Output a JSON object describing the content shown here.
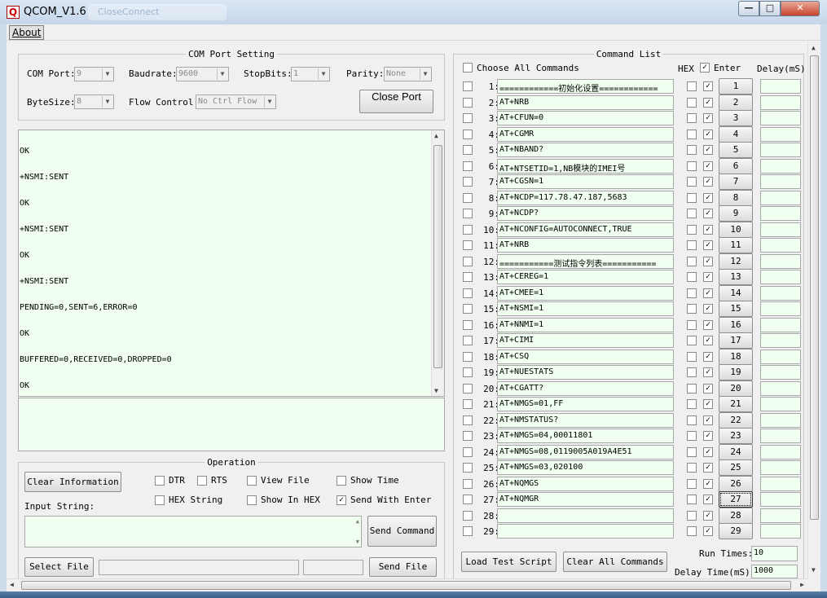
{
  "window": {
    "title": "QCOM_V1.6",
    "ghost_tab": "CloseConnect"
  },
  "menu": {
    "about": "About"
  },
  "com_port_setting": {
    "legend": "COM Port Setting",
    "com_port_label": "COM Port:",
    "com_port_value": "9",
    "baudrate_label": "Baudrate:",
    "baudrate_value": "9600",
    "stopbits_label": "StopBits:",
    "stopbits_value": "1",
    "parity_label": "Parity:",
    "parity_value": "None",
    "bytesize_label": "ByteSize:",
    "bytesize_value": "8",
    "flow_label": "Flow Control:",
    "flow_value": "No Ctrl Flow",
    "close_port": "Close Port"
  },
  "receive_lines": [
    "OK",
    "+NSMI:SENT",
    "OK",
    "+NSMI:SENT",
    "OK",
    "+NSMI:SENT",
    "PENDING=0,SENT=6,ERROR=0",
    "OK",
    "BUFFERED=0,RECEIVED=0,DROPPED=0",
    "OK"
  ],
  "operation": {
    "legend": "Operation",
    "clear_information": "Clear Information",
    "dtr": "DTR",
    "rts": "RTS",
    "view_file": "View File",
    "show_time": "Show Time",
    "hex_string": "HEX String",
    "show_in_hex": "Show In HEX",
    "send_with_enter": "Send With Enter",
    "input_string_label": "Input String:",
    "send_command": "Send Command",
    "select_file": "Select File",
    "send_file": "Send File"
  },
  "command_list": {
    "legend": "Command List",
    "choose_all": "Choose All Commands",
    "hex_header": "HEX",
    "enter_header": "Enter",
    "delay_header": "Delay(mS)",
    "commands": [
      "============初始化设置============",
      "AT+NRB",
      "AT+CFUN=0",
      "AT+CGMR",
      "AT+NBAND?",
      "AT+NTSETID=1,NB模块的IMEI号",
      "AT+CGSN=1",
      "AT+NCDP=117.78.47.187,5683",
      "AT+NCDP?",
      "AT+NCONFIG=AUTOCONNECT,TRUE",
      "AT+NRB",
      "===========测试指令列表===========",
      "AT+CEREG=1",
      "AT+CMEE=1",
      "AT+NSMI=1",
      "AT+NNMI=1",
      "AT+CIMI",
      "AT+CSQ",
      "AT+NUESTATS",
      "AT+CGATT?",
      "AT+NMGS=01,FF",
      "AT+NMSTATUS?",
      "AT+NMGS=04,00011801",
      "AT+NMGS=08,0119005A019A4E51",
      "AT+NMGS=03,020100",
      "AT+NQMGS",
      "AT+NQMGR",
      "",
      ""
    ],
    "load_test_script": "Load Test Script",
    "clear_all_commands": "Clear All Commands",
    "run_times_label": "Run Times:",
    "run_times_value": "10",
    "delay_time_label": "Delay Time(mS):",
    "delay_time_value": "1000"
  },
  "icons": {
    "check": "✓",
    "down": "▼",
    "up": "▲"
  }
}
